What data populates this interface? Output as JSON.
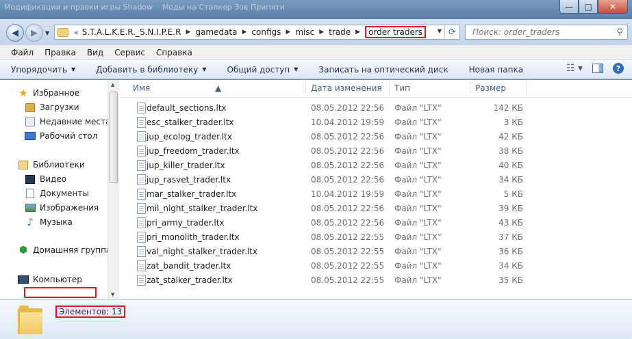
{
  "window": {
    "title_tabs": [
      "Модификации и правки игры Shadow",
      "Моды на Сталкер Зов Припяти"
    ],
    "btn_min": "—",
    "btn_max": "□",
    "btn_close": "✕"
  },
  "address": {
    "overflow": "«",
    "crumbs": [
      "S.T.A.L.K.E.R._S.N.I.P.E.R",
      "gamedata",
      "configs",
      "misc",
      "trade"
    ],
    "current": "order traders"
  },
  "search": {
    "placeholder": "Поиск: order_traders"
  },
  "menu": [
    "Файл",
    "Правка",
    "Вид",
    "Сервис",
    "Справка"
  ],
  "commands": [
    "Упорядочить",
    "Добавить в библиотеку",
    "Общий доступ",
    "Записать на оптический диск",
    "Новая папка"
  ],
  "nav": {
    "favorites": "Избранное",
    "downloads": "Загрузки",
    "recent": "Недавние места",
    "desktop": "Рабочий стол",
    "libraries": "Библиотеки",
    "video": "Видео",
    "documents": "Документы",
    "images": "Изображения",
    "music": "Музыка",
    "homegroup": "Домашняя группа",
    "computer": "Компьютер"
  },
  "columns": {
    "name": "Имя",
    "date": "Дата изменения",
    "type": "Тип",
    "size": "Размер"
  },
  "files": [
    {
      "name": "default_sections.ltx",
      "date": "08.05.2012 22:56",
      "type": "Файл \"LTX\"",
      "size": "142 КБ"
    },
    {
      "name": "esc_stalker_trader.ltx",
      "date": "10.04.2012 19:59",
      "type": "Файл \"LTX\"",
      "size": "3 КБ"
    },
    {
      "name": "jup_ecolog_trader.ltx",
      "date": "08.05.2012 22:56",
      "type": "Файл \"LTX\"",
      "size": "42 КБ"
    },
    {
      "name": "jup_freedom_trader.ltx",
      "date": "08.05.2012 22:56",
      "type": "Файл \"LTX\"",
      "size": "38 КБ"
    },
    {
      "name": "jup_killer_trader.ltx",
      "date": "08.05.2012 22:56",
      "type": "Файл \"LTX\"",
      "size": "40 КБ"
    },
    {
      "name": "jup_rasvet_trader.ltx",
      "date": "08.05.2012 22:56",
      "type": "Файл \"LTX\"",
      "size": "34 КБ"
    },
    {
      "name": "mar_stalker_trader.ltx",
      "date": "10.04.2012 19:59",
      "type": "Файл \"LTX\"",
      "size": "5 КБ"
    },
    {
      "name": "mil_night_stalker_trader.ltx",
      "date": "08.05.2012 22:56",
      "type": "Файл \"LTX\"",
      "size": "39 КБ"
    },
    {
      "name": "pri_army_trader.ltx",
      "date": "08.05.2012 22:56",
      "type": "Файл \"LTX\"",
      "size": "43 КБ"
    },
    {
      "name": "pri_monolith_trader.ltx",
      "date": "08.05.2012 22:55",
      "type": "Файл \"LTX\"",
      "size": "37 КБ"
    },
    {
      "name": "val_night_stalker_trader.ltx",
      "date": "08.05.2012 22:55",
      "type": "Файл \"LTX\"",
      "size": "36 КБ"
    },
    {
      "name": "zat_bandit_trader.ltx",
      "date": "08.05.2012 22:55",
      "type": "Файл \"LTX\"",
      "size": "34 КБ"
    },
    {
      "name": "zat_stalker_trader.ltx",
      "date": "08.05.2012 22:55",
      "type": "Файл \"LTX\"",
      "size": "35 КБ"
    }
  ],
  "status": {
    "items": "Элементов: 13"
  }
}
